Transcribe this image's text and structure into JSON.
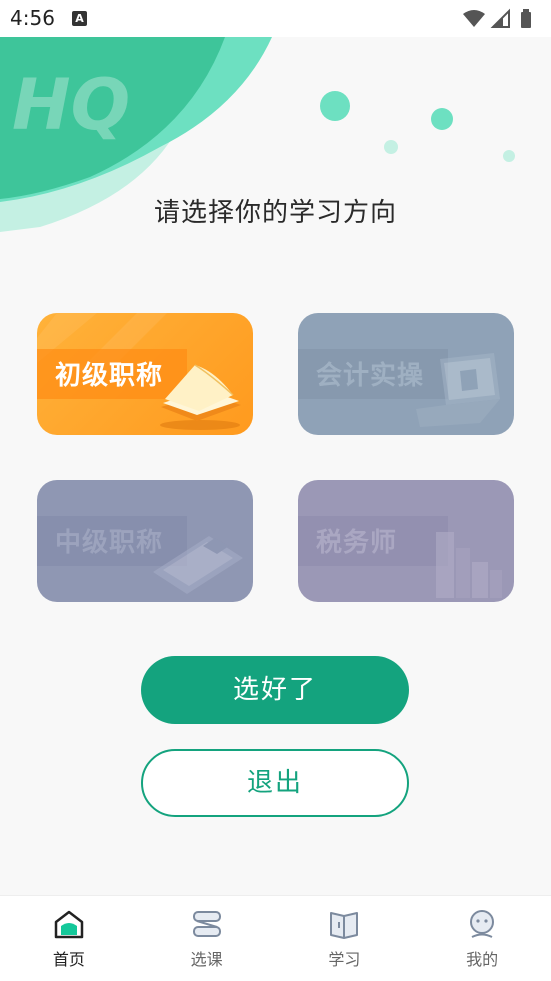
{
  "status_bar": {
    "time": "4:56",
    "notification_icon": "A"
  },
  "page": {
    "title": "请选择你的学习方向",
    "logo_text": "HQ"
  },
  "directions": [
    {
      "label": "初级职称",
      "icon": "book-icon",
      "selected": true
    },
    {
      "label": "会计实操",
      "icon": "laptop-icon",
      "selected": false
    },
    {
      "label": "中级职称",
      "icon": "calculator-icon",
      "selected": false
    },
    {
      "label": "税务师",
      "icon": "building-icon",
      "selected": false
    }
  ],
  "actions": {
    "confirm": "选好了",
    "exit": "退出"
  },
  "nav": [
    {
      "label": "首页",
      "icon": "home-icon",
      "active": true
    },
    {
      "label": "选课",
      "icon": "courses-icon",
      "active": false
    },
    {
      "label": "学习",
      "icon": "study-book-icon",
      "active": false
    },
    {
      "label": "我的",
      "icon": "profile-icon",
      "active": false
    }
  ],
  "colors": {
    "accent": "#14a37e",
    "selected_card": "#ffa52a",
    "header_teal": "#5fd3b3"
  }
}
